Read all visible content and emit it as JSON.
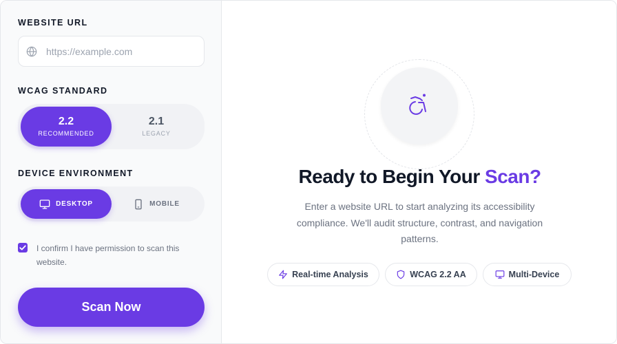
{
  "form": {
    "url_label": "WEBSITE URL",
    "url_placeholder": "https://example.com",
    "url_value": "",
    "wcag_label": "WCAG STANDARD",
    "wcag_options": [
      {
        "version": "2.2",
        "sublabel": "RECOMMENDED",
        "selected": true
      },
      {
        "version": "2.1",
        "sublabel": "LEGACY",
        "selected": false
      }
    ],
    "device_label": "DEVICE ENVIRONMENT",
    "device_options": [
      {
        "label": "DESKTOP",
        "icon": "monitor-icon",
        "selected": true
      },
      {
        "label": "MOBILE",
        "icon": "smartphone-icon",
        "selected": false
      }
    ],
    "permission_checked": true,
    "permission_text": "I confirm I have permission to scan this website.",
    "scan_button": "Scan Now"
  },
  "hero": {
    "icon": "accessibility-icon",
    "title_main": "Ready to Begin Your ",
    "title_accent": "Scan?",
    "description": "Enter a website URL to start analyzing its accessibility compliance. We'll audit structure, contrast, and navigation patterns.",
    "features": [
      {
        "label": "Real-time Analysis",
        "icon": "lightning-icon"
      },
      {
        "label": "WCAG 2.2 AA",
        "icon": "shield-icon"
      },
      {
        "label": "Multi-Device",
        "icon": "monitor-icon"
      }
    ]
  },
  "colors": {
    "accent": "#6a3be4",
    "panel_bg": "#f9fafb",
    "muted_text": "#6b7280"
  }
}
